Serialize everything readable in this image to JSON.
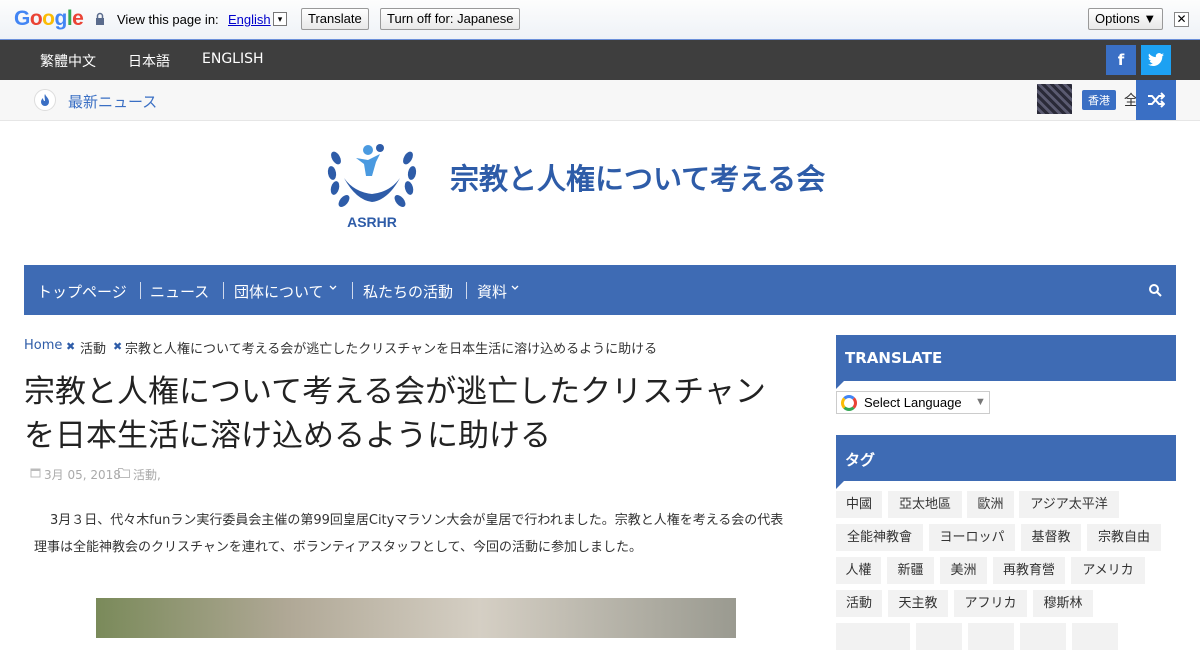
{
  "translate_bar": {
    "logo": "Google",
    "prompt": "View this page in:",
    "language": "English",
    "translate_label": "Translate",
    "turn_off_label": "Turn off for: Japanese",
    "options_label": "Options ▼",
    "close_glyph": "✕"
  },
  "topbar": {
    "languages": [
      "繁體中文",
      "日本語",
      "ENGLISH"
    ],
    "facebook_glyph": "f",
    "twitter_glyph": "t"
  },
  "ticker": {
    "label": "最新ニュース",
    "badge": "香港",
    "headline": "全"
  },
  "site": {
    "emblem_text": "ASRHR",
    "title": "宗教と人権について考える会"
  },
  "main_nav": {
    "items": [
      "トップページ",
      "ニュース",
      "団体について",
      "私たちの活動",
      "資料"
    ]
  },
  "breadcrumb": {
    "home": "Home",
    "category": "活動",
    "current": "宗教と人権について考える会が逃亡したクリスチャンを日本生活に溶け込めるように助ける"
  },
  "article": {
    "title": "宗教と人権について考える会が逃亡したクリスチャンを日本生活に溶け込めるように助ける",
    "date": "3月 05, 2018",
    "category": "活動,",
    "body": "3月３日、代々木funラン実行委員会主催の第99回皇居Cityマラソン大会が皇居で行われました。宗教と人権を考える会の代表理事は全能神教会のクリスチャンを連れて、ボランティアスタッフとして、今回の活動に参加しました。"
  },
  "sidebar": {
    "translate_heading": "TRANSLATE",
    "select_language": "Select Language",
    "select_arrow": "▼",
    "tags_heading": "タグ",
    "tags": [
      "中國",
      "亞太地區",
      "歐洲",
      "アジア太平洋",
      "全能神教會",
      "ヨーロッパ",
      "基督教",
      "宗教自由",
      "人權",
      "新疆",
      "美洲",
      "再教育營",
      "アメリカ",
      "活動",
      "天主教",
      "アフリカ",
      "穆斯林"
    ]
  },
  "colors": {
    "brand_blue": "#3e6bb4",
    "dark_bar": "#3e3e3e",
    "title_blue": "#2e5ca8"
  }
}
